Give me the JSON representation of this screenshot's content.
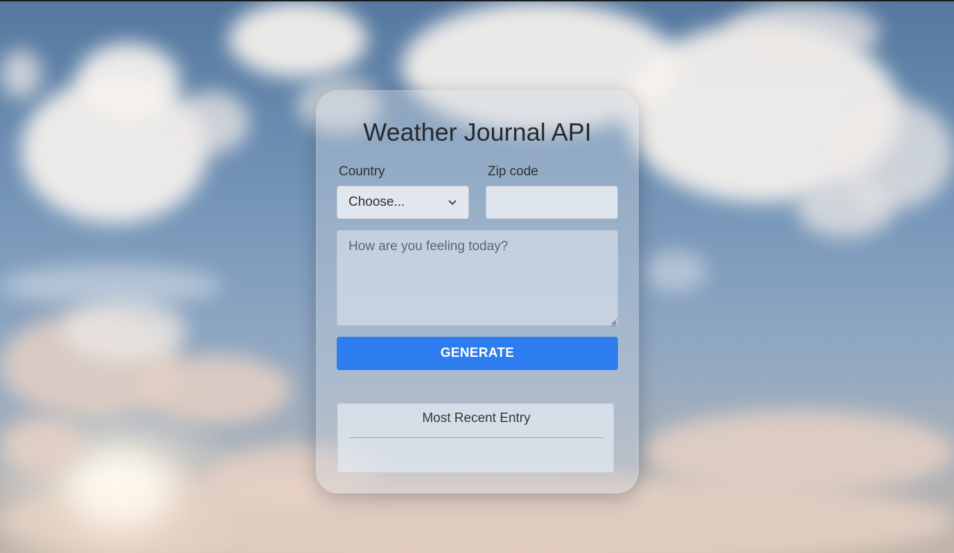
{
  "app": {
    "title": "Weather Journal API"
  },
  "form": {
    "country_label": "Country",
    "country_selected": "Choose...",
    "zip_label": "Zip code",
    "zip_value": "",
    "zip_placeholder": "",
    "feelings_placeholder": "How are you feeling today?",
    "feelings_value": "",
    "generate_label": "GENERATE"
  },
  "recent_entry": {
    "heading": "Most Recent Entry",
    "content": ""
  },
  "icons": {
    "select_arrow": "chevron-down-icon",
    "textarea_resize": "resize-handle-icon"
  },
  "colors": {
    "primary_button": "#2d7cf0",
    "title_text": "#262a2f"
  }
}
